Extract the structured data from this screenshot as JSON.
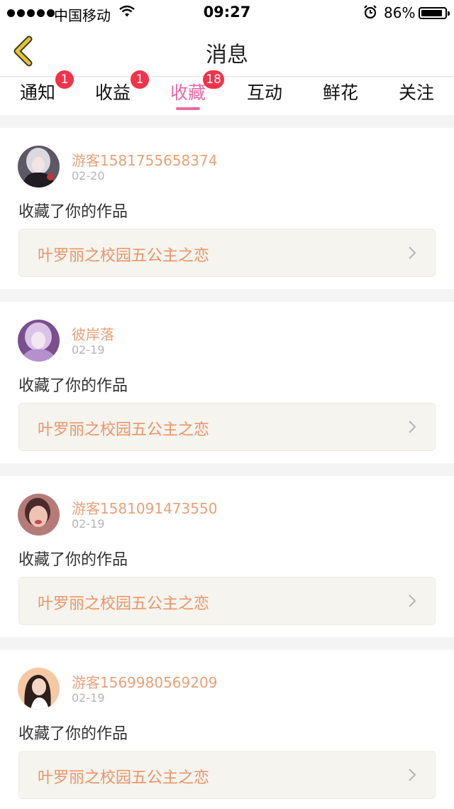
{
  "statusbar": {
    "carrier": "中国移动",
    "time": "09:27",
    "battery": "86%",
    "icons": [
      "signal-dots-icon",
      "wifi-icon",
      "alarm-clock-icon",
      "battery-icon"
    ]
  },
  "navbar": {
    "title": "消息",
    "back_icon": "chevron-left-icon",
    "back_color": "#e2c33a"
  },
  "tabs": [
    {
      "label": "通知",
      "badge": "1",
      "active": false
    },
    {
      "label": "收益",
      "badge": "1",
      "active": false
    },
    {
      "label": "收藏",
      "badge": "18",
      "active": true
    },
    {
      "label": "互动",
      "badge": "",
      "active": false
    },
    {
      "label": "鲜花",
      "badge": "",
      "active": false
    },
    {
      "label": "关注",
      "badge": "",
      "active": false
    }
  ],
  "colors": {
    "accent": "#e96aa2",
    "badge": "#f0334a",
    "username": "#e8a078",
    "work_title": "#eb9468"
  },
  "feed": [
    {
      "user": "游客1581755658374",
      "date": "02-20",
      "action": "收藏了你的作品",
      "work_title": "叶罗丽之校园五公主之恋"
    },
    {
      "user": "彼岸落",
      "date": "02-19",
      "action": "收藏了你的作品",
      "work_title": "叶罗丽之校园五公主之恋"
    },
    {
      "user": "游客1581091473550",
      "date": "02-19",
      "action": "收藏了你的作品",
      "work_title": "叶罗丽之校园五公主之恋"
    },
    {
      "user": "游客1569980569209",
      "date": "02-19",
      "action": "收藏了你的作品",
      "work_title": "叶罗丽之校园五公主之恋"
    }
  ]
}
